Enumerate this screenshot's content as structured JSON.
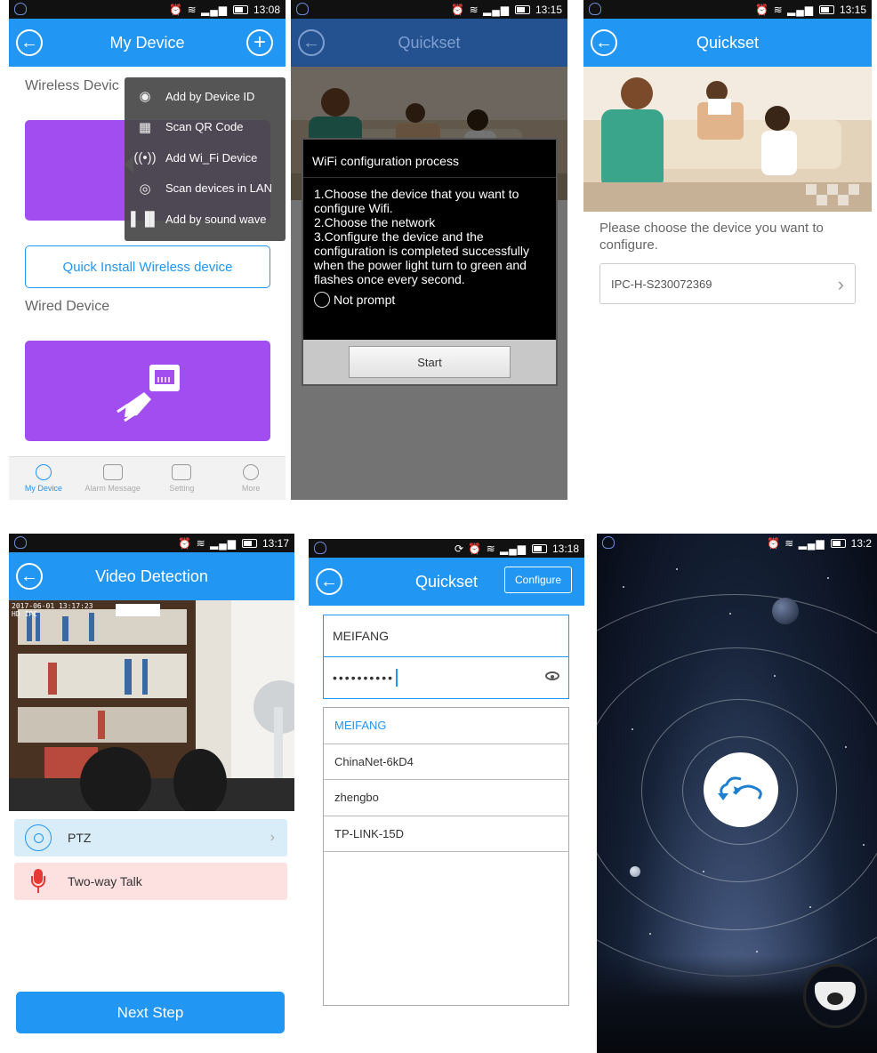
{
  "screen1": {
    "time": "13:08",
    "title": "My Device",
    "wireless_label": "Wireless Devic",
    "wired_label": "Wired Device",
    "quick_install": "Quick Install Wireless device",
    "menu": [
      {
        "label": "Add by Device ID",
        "icon": "webcam-icon"
      },
      {
        "label": "Scan QR Code",
        "icon": "qr-code-icon"
      },
      {
        "label": "Add Wi_Fi Device",
        "icon": "wifi-signal-icon"
      },
      {
        "label": "Scan devices in LAN",
        "icon": "radar-icon"
      },
      {
        "label": "Add by sound wave",
        "icon": "sound-wave-icon"
      }
    ],
    "nav": [
      {
        "label": "My Device",
        "icon": "camera-icon"
      },
      {
        "label": "Alarm Message",
        "icon": "message-icon"
      },
      {
        "label": "Setting",
        "icon": "settings-icon"
      },
      {
        "label": "More",
        "icon": "more-icon"
      }
    ],
    "accent": "#2196f3",
    "card_color": "#a14df0"
  },
  "screen2": {
    "time": "13:15",
    "title": "Quickset",
    "dialog_title": "WiFi configuration process",
    "step1": "1.Choose the device that you want to configure Wifi.",
    "step2": "2.Choose the network",
    "step3": "3.Configure the device and the configuration is completed successfully when the power light turn to green and flashes once every second.",
    "not_prompt": "Not prompt",
    "start": "Start"
  },
  "screen3": {
    "time": "13:15",
    "title": "Quickset",
    "instruction": "Please choose the device you want to configure.",
    "device": "IPC-H-S230072369"
  },
  "screen4": {
    "time": "13:17",
    "title": "Video Detection",
    "overlay": "2017-06-01 13:17:23",
    "overlay_sub": "HD IPC",
    "ptz": "PTZ",
    "talk": "Two-way Talk",
    "next": "Next Step"
  },
  "screen5": {
    "time": "13:18",
    "title": "Quickset",
    "configure": "Configure",
    "ssid": "MEIFANG",
    "password_mask": "••••••••••",
    "networks": [
      "MEIFANG",
      "ChinaNet-6kD4",
      "zhengbo",
      "TP-LINK-15D"
    ]
  },
  "screen6": {
    "time": "13:2"
  }
}
